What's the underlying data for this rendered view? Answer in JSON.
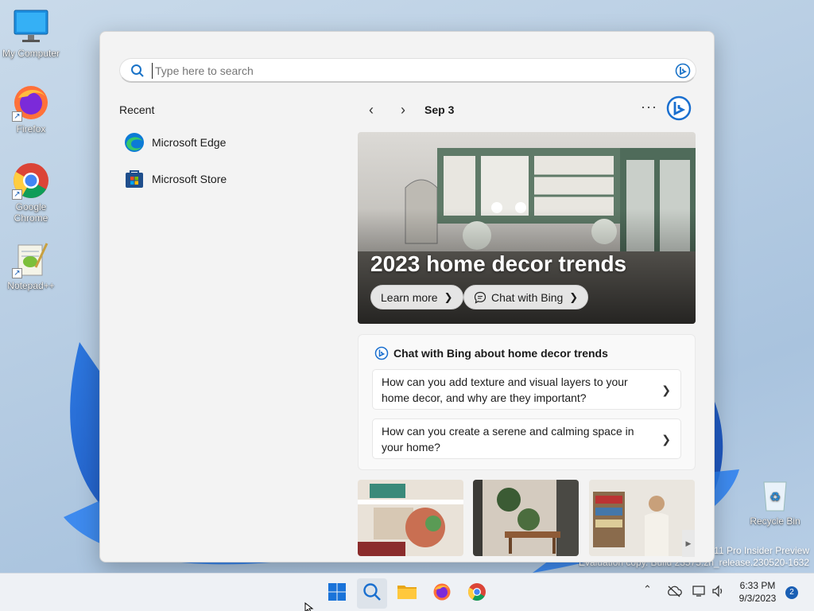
{
  "desktop": {
    "icons": [
      {
        "label": "My Computer",
        "icon": "monitor-icon"
      },
      {
        "label": "Firefox",
        "icon": "firefox-icon"
      },
      {
        "label": "Google Chrome",
        "icon": "chrome-icon"
      },
      {
        "label": "Notepad++",
        "icon": "notepadpp-icon"
      },
      {
        "label": "Recycle Bin",
        "icon": "recycle-bin-icon"
      }
    ],
    "watermark": {
      "line1": "11 Pro Insider Preview",
      "line2": "Evaluation copy. Build 23575.zn_release.230520-1632"
    }
  },
  "search_panel": {
    "search": {
      "placeholder": "Type here to search",
      "value": ""
    },
    "recent": {
      "title": "Recent",
      "items": [
        {
          "label": "Microsoft Edge",
          "icon": "edge-icon"
        },
        {
          "label": "Microsoft Store",
          "icon": "store-icon"
        }
      ]
    },
    "highlights": {
      "date": "Sep 3",
      "hero": {
        "title": "2023 home decor trends",
        "learn_more": "Learn more",
        "chat_with_bing": "Chat with Bing"
      },
      "chat_card": {
        "title": "Chat with Bing about home decor trends",
        "questions": [
          "How can you add texture and visual layers to your home decor, and why are they important?",
          "How can you create a serene and calming space in your home?"
        ]
      }
    }
  },
  "taskbar": {
    "apps": [
      "start-icon",
      "search-icon",
      "file-explorer-icon",
      "firefox-icon",
      "chrome-icon"
    ],
    "clock": {
      "time": "6:33 PM",
      "date": "9/3/2023"
    },
    "notification_count": "2"
  }
}
